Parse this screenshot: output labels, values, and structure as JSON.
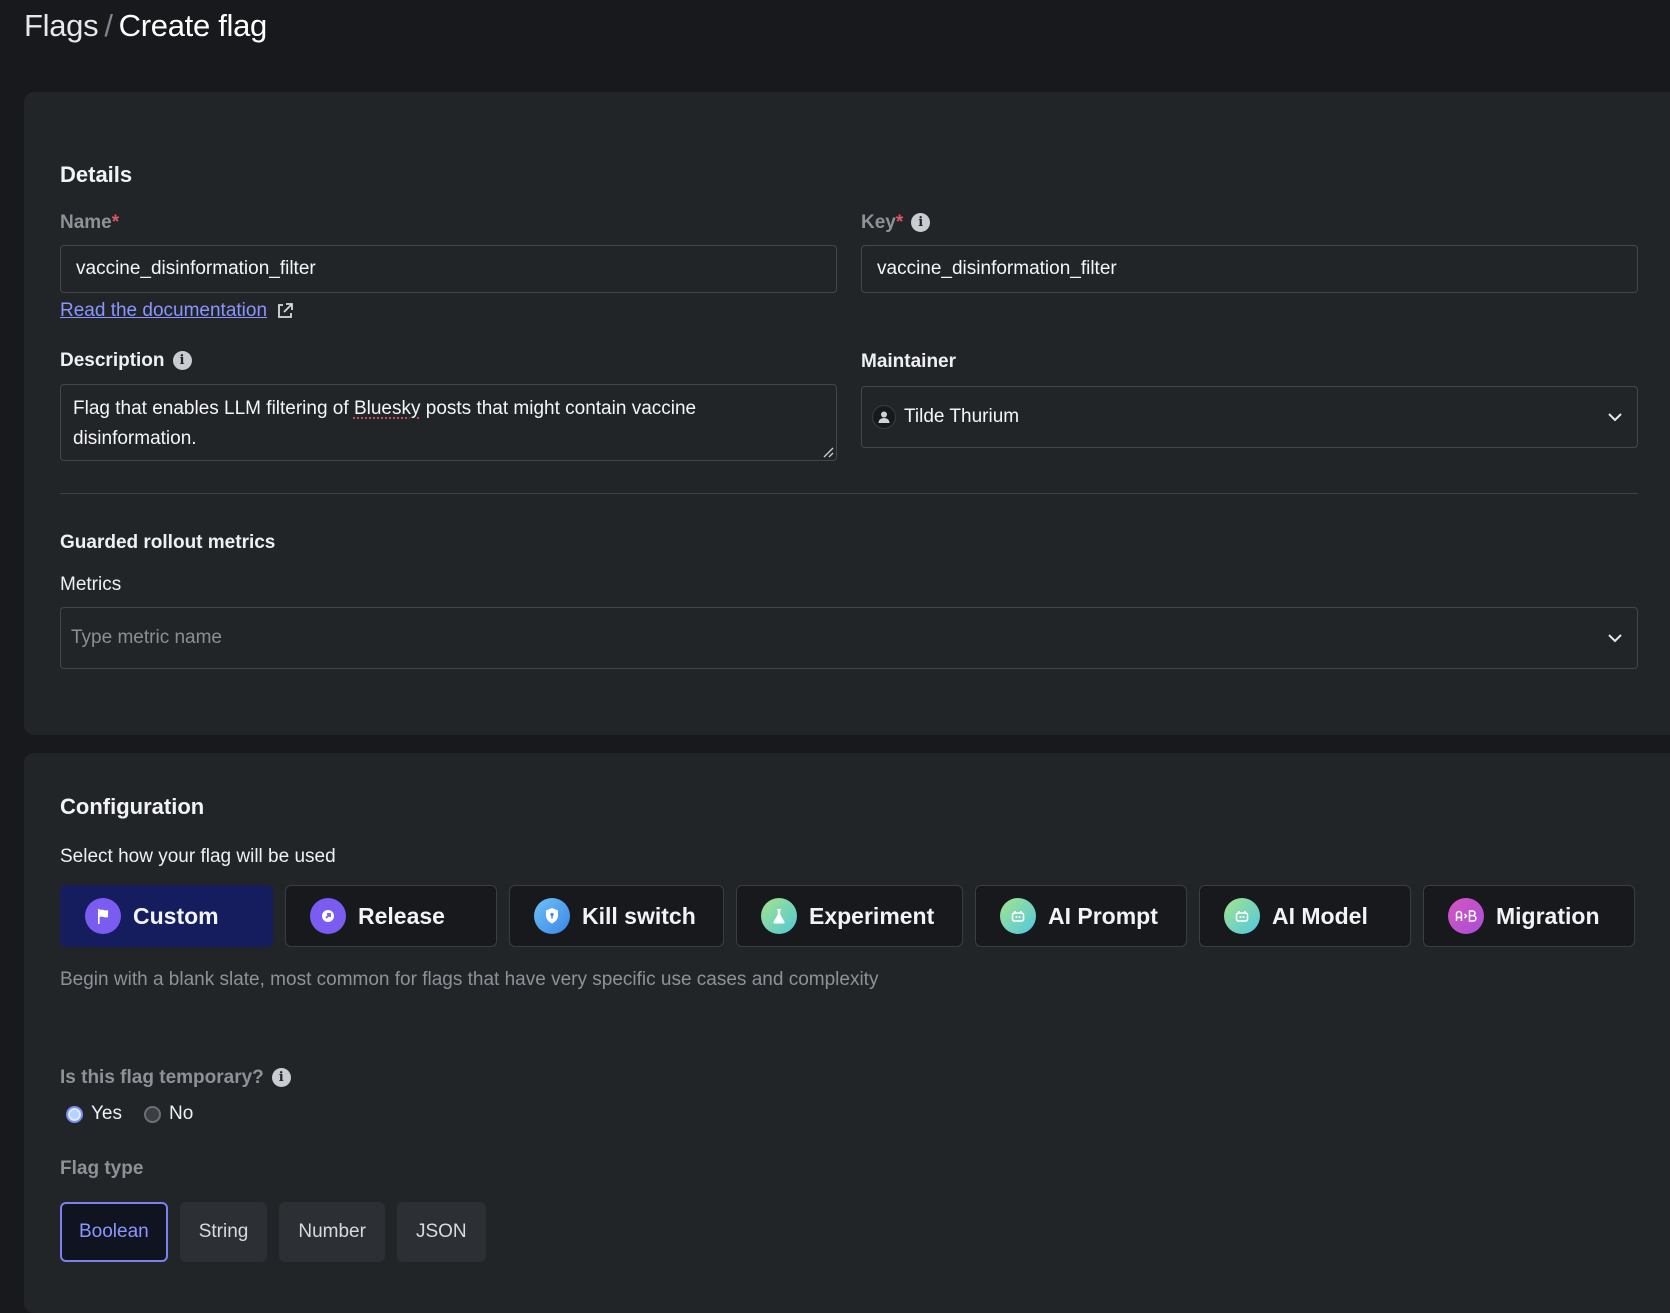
{
  "header": {
    "breadcrumb_parent": "Flags",
    "breadcrumb_separator": "/",
    "breadcrumb_current": "Create flag"
  },
  "details": {
    "section_title": "Details",
    "name_label": "Name",
    "required_mark": "*",
    "name_value": "vaccine_disinformation_filter",
    "key_label": "Key",
    "key_value": "vaccine_disinformation_filter",
    "doc_link": "Read the documentation",
    "description_label": "Description",
    "description_before": "Flag that enables LLM filtering of ",
    "description_misspelled": "Bluesky",
    "description_after": " posts that might contain vaccine disinformation.",
    "maintainer_label": "Maintainer",
    "maintainer_value": "Tilde Thurium",
    "guarded_title": "Guarded rollout metrics",
    "metrics_label": "Metrics",
    "metrics_placeholder": "Type metric name"
  },
  "configuration": {
    "section_title": "Configuration",
    "subtitle": "Select how your flag will be used",
    "types": [
      {
        "label": "Custom",
        "icon": "flag-icon",
        "color": "#7a5cf0",
        "selected": true
      },
      {
        "label": "Release",
        "icon": "arrow-up-right-icon",
        "color": "#7a5cf0",
        "selected": false
      },
      {
        "label": "Kill switch",
        "icon": "shield-icon",
        "color": "#4aa8f0",
        "selected": false
      },
      {
        "label": "Experiment",
        "icon": "flask-icon",
        "color": "#6fd4a8",
        "selected": false
      },
      {
        "label": "AI Prompt",
        "icon": "robot-icon",
        "color": "#6fd4b8",
        "selected": false
      },
      {
        "label": "AI Model",
        "icon": "robot-icon",
        "color": "#6fd4b8",
        "selected": false
      },
      {
        "label": "Migration",
        "icon": "ab-icon",
        "color": "#c84fc8",
        "selected": false
      }
    ],
    "type_description": "Begin with a blank slate, most common for flags that have very specific use cases and complexity",
    "temporary_label": "Is this flag temporary?",
    "temporary_options": [
      {
        "label": "Yes",
        "checked": true
      },
      {
        "label": "No",
        "checked": false
      }
    ],
    "flag_type_label": "Flag type",
    "flag_types": [
      {
        "label": "Boolean",
        "selected": true
      },
      {
        "label": "String",
        "selected": false
      },
      {
        "label": "Number",
        "selected": false
      },
      {
        "label": "JSON",
        "selected": false
      }
    ]
  },
  "colors": {
    "accent": "#7b82ee",
    "link": "#8a95ff",
    "selected_type_bg": "#151d5e",
    "required": "#e0556b"
  }
}
